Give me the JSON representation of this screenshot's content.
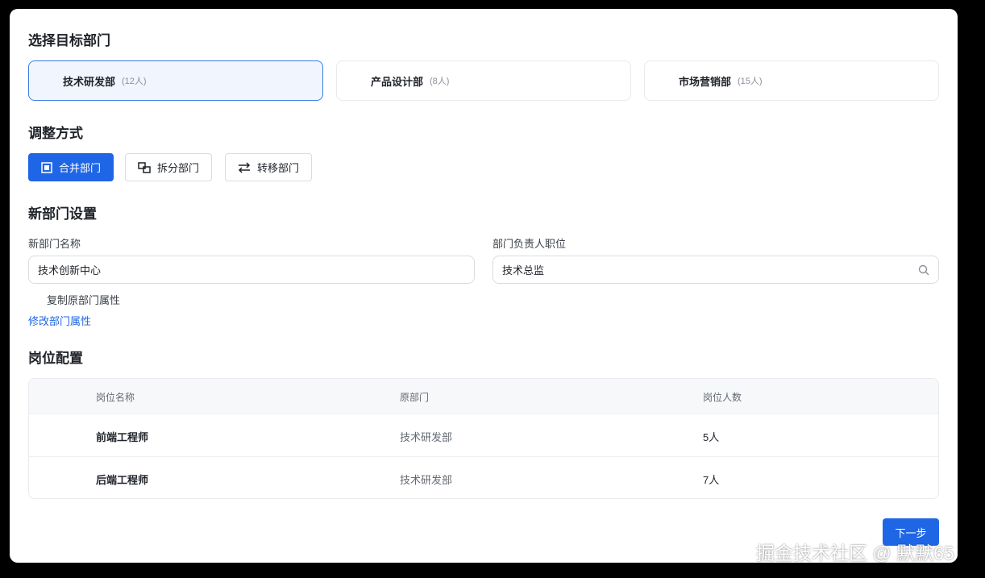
{
  "sections": {
    "select_dept": "选择目标部门",
    "adjust_mode": "调整方式",
    "new_dept_settings": "新部门设置",
    "position_config": "岗位配置"
  },
  "departments": [
    {
      "name": "技术研发部",
      "count": "(12人)",
      "selected": true
    },
    {
      "name": "产品设计部",
      "count": "(8人)",
      "selected": false
    },
    {
      "name": "市场营销部",
      "count": "(15人)",
      "selected": false
    }
  ],
  "modes": [
    {
      "label": "合并部门",
      "icon": "merge-icon",
      "active": true
    },
    {
      "label": "拆分部门",
      "icon": "split-icon",
      "active": false
    },
    {
      "label": "转移部门",
      "icon": "transfer-icon",
      "active": false
    }
  ],
  "form": {
    "name_label": "新部门名称",
    "name_value": "技术创新中心",
    "leader_label": "部门负责人职位",
    "leader_value": "技术总监",
    "copy_attrs": "复制原部门属性",
    "modify_attrs": "修改部门属性"
  },
  "table": {
    "headers": [
      "岗位名称",
      "原部门",
      "岗位人数"
    ],
    "rows": [
      {
        "name": "前端工程师",
        "dept": "技术研发部",
        "count": "5人"
      },
      {
        "name": "后端工程师",
        "dept": "技术研发部",
        "count": "7人"
      }
    ]
  },
  "actions": {
    "next": "下一步"
  },
  "watermark": "掘金技术社区 @ 默默65",
  "colors": {
    "primary": "#1f66e6",
    "selected_border": "#3b7ce4",
    "selected_bg": "#f0f5fe",
    "link": "#1f66e6"
  }
}
